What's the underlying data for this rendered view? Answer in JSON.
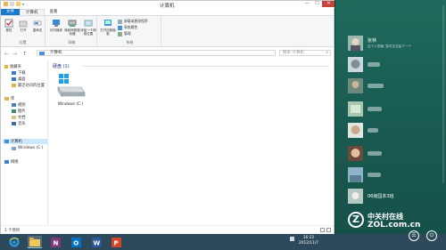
{
  "window": {
    "title": "计算机",
    "tabs": [
      "文件",
      "计算机",
      "查看"
    ],
    "controls": {
      "minimize": "—",
      "maximize": "☐",
      "close": "✕"
    }
  },
  "ribbon": {
    "groups": [
      {
        "label": "位置",
        "buttons": [
          "属性",
          "打开",
          "重命名"
        ]
      },
      {
        "label": "网络",
        "buttons": [
          "访问媒体",
          "映射网络驱动器",
          "添加一个网络位置"
        ]
      },
      {
        "label": "系统",
        "buttons": [
          "打开控制面板"
        ],
        "small": [
          "卸载或更改程序",
          "系统属性",
          "管理"
        ]
      }
    ]
  },
  "address": {
    "nav": [
      "←",
      "→",
      "↑"
    ],
    "path": "计算机",
    "search_placeholder": "搜索 计算机"
  },
  "navpane": {
    "favorites": "收藏夹",
    "favorite_items": [
      "下载",
      "桌面",
      "最近访问的位置"
    ],
    "libraries": "库",
    "library_items": [
      "视频",
      "图片",
      "文档",
      "音乐"
    ],
    "computer": "计算机",
    "computer_items": [
      "Windows (C:)"
    ],
    "network": "网络"
  },
  "content": {
    "group_header": "硬盘 (1)",
    "drive_label": "Windows (C:)"
  },
  "statusbar": {
    "text": "1 个项目"
  },
  "people": {
    "contacts": [
      {
        "name": "张林",
        "status": "这个人很懒, 暂时还没留下一个"
      },
      {
        "name": "",
        "status": ""
      },
      {
        "name": "",
        "status": ""
      },
      {
        "name": "",
        "status": ""
      },
      {
        "name": "",
        "status": ""
      },
      {
        "name": "",
        "status": ""
      },
      {
        "name": "",
        "status": ""
      },
      {
        "name": "",
        "status": ""
      },
      {
        "name": "06级园本3班",
        "status": ""
      }
    ],
    "watermark_cn": "中关村在线",
    "watermark_en": "ZOL.com.cn"
  },
  "taskbar": {
    "apps": [
      "internet-explorer-icon",
      "file-explorer-icon",
      "onenote-icon",
      "outlook-icon",
      "word-icon",
      "powerpoint-icon"
    ],
    "time": "16:22",
    "date": "2012/11/7"
  },
  "colors": {
    "file_tab": "#1979ca",
    "close_btn": "#c8433c",
    "people_bg": "#1a5e54",
    "taskbar": "#2c4a5c"
  }
}
